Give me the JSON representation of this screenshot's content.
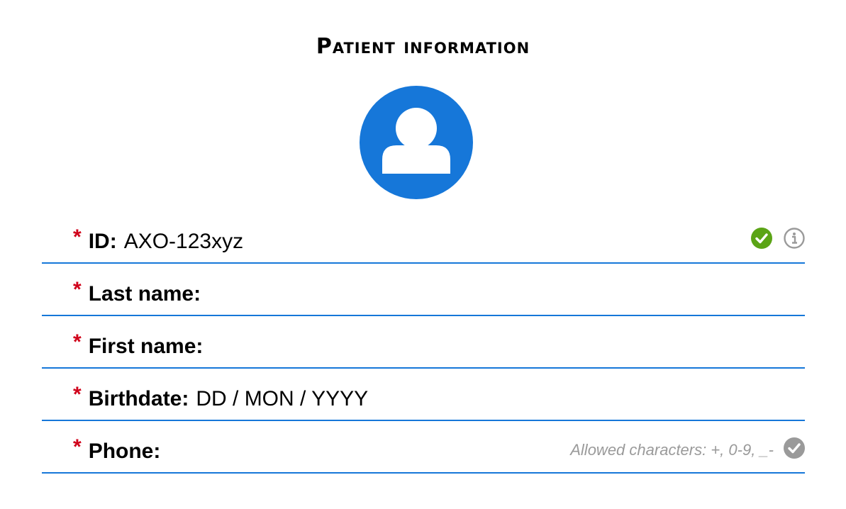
{
  "form": {
    "title": "Patient information",
    "fields": [
      {
        "label": "ID:",
        "value": "AXO-123xyz",
        "required_mark": "*"
      },
      {
        "label": "Last name:",
        "value": "",
        "required_mark": "*"
      },
      {
        "label": "First name:",
        "value": "",
        "required_mark": "*"
      },
      {
        "label": "Birthdate:",
        "value": "DD / MON / YYYY",
        "required_mark": "*"
      },
      {
        "label": "Phone:",
        "value": "",
        "required_mark": "*",
        "hint": "Allowed characters: +, 0-9, _-"
      }
    ]
  },
  "icons": {
    "avatar": "user-avatar-icon",
    "id_valid": "check-circle-icon",
    "id_info": "info-icon",
    "phone_status": "check-circle-icon"
  },
  "colors": {
    "accent": "#1677d9",
    "required": "#d0021b",
    "valid": "#5ba416",
    "muted": "#9a9a9a"
  }
}
